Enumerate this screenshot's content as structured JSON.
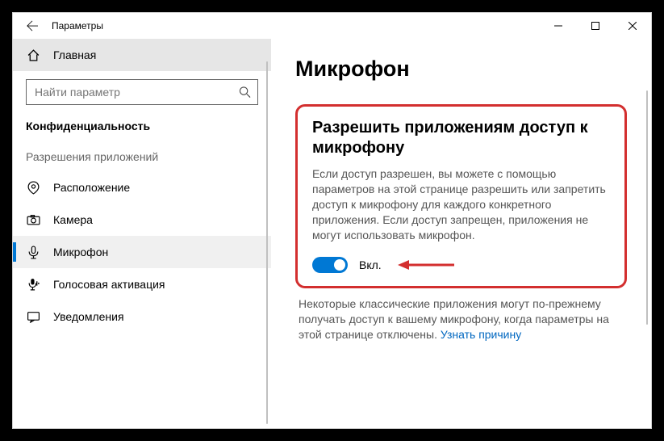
{
  "window": {
    "title": "Параметры"
  },
  "sidebar": {
    "home_label": "Главная",
    "search_placeholder": "Найти параметр",
    "section_title": "Конфиденциальность",
    "subhead": "Разрешения приложений",
    "items": [
      {
        "label": "Расположение"
      },
      {
        "label": "Камера"
      },
      {
        "label": "Микрофон"
      },
      {
        "label": "Голосовая активация"
      },
      {
        "label": "Уведомления"
      }
    ]
  },
  "content": {
    "page_title": "Микрофон",
    "section_heading": "Разрешить приложениям доступ к микрофону",
    "section_desc": "Если доступ разрешен, вы можете с помощью параметров на этой странице разрешить или запретить доступ к микрофону для каждого конкретного приложения. Если доступ запрещен, приложения не могут использовать микрофон.",
    "toggle_state": "on",
    "toggle_label": "Вкл.",
    "note_text": "Некоторые классические приложения могут по-прежнему получать доступ к вашему микрофону, когда параметры на этой странице отключены. ",
    "note_link": "Узнать причину"
  }
}
